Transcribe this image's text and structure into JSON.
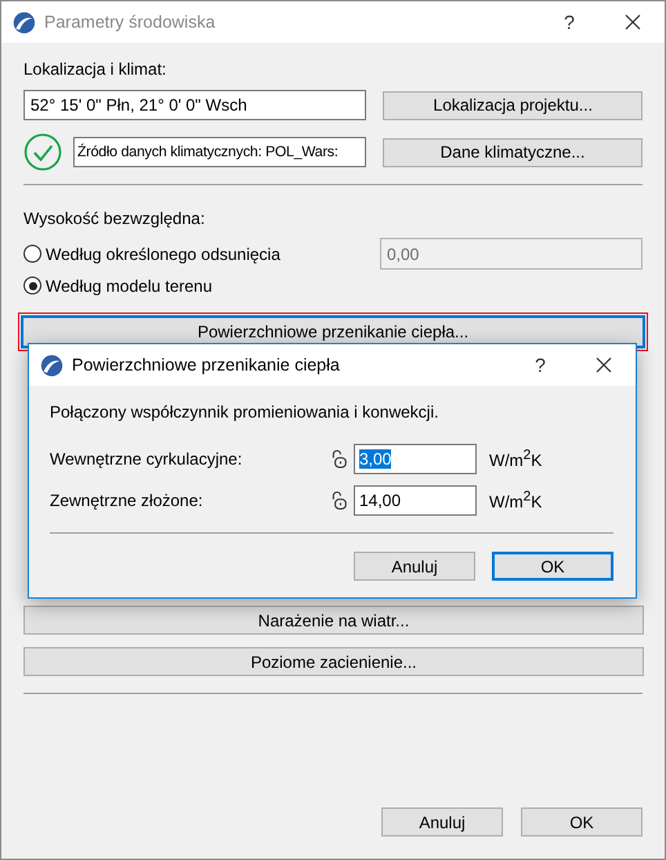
{
  "window": {
    "title": "Parametry środowiska",
    "help": "?"
  },
  "location": {
    "label": "Lokalizacja i klimat:",
    "coordinates": "52° 15' 0\" Płn, 21° 0' 0\" Wsch",
    "button": "Lokalizacja projektu..."
  },
  "climate": {
    "valid": true,
    "source": "Źródło danych klimatycznych: POL_Wars:",
    "button": "Dane klimatyczne..."
  },
  "elevation": {
    "label": "Wysokość bezwzględna:",
    "options": [
      {
        "label": "Według określonego odsunięcia",
        "selected": false
      },
      {
        "label": "Według modelu terenu",
        "selected": true
      }
    ],
    "offset_value": "0,00",
    "offset_disabled": true
  },
  "heat_button": {
    "label": "Powierzchniowe przenikanie ciepła...",
    "focused": true
  },
  "wind_button": "Narażenie na wiatr...",
  "shading_button": "Poziome zacienienie...",
  "buttons": [
    {
      "label": "Anuluj",
      "default": false
    },
    {
      "label": "OK",
      "default": false
    }
  ],
  "dialog": {
    "title": "Powierzchniowe przenikanie ciepła",
    "help": "?",
    "description": "Połączony współczynnik promieniowania i konwekcji.",
    "rows": [
      {
        "label": "Wewnętrzne cyrkulacyjne:",
        "value": "3,00",
        "unit": "W/m$^{2}$K",
        "locked": false,
        "focused": true
      },
      {
        "label": "Zewnętrzne złożone:",
        "value": "14,00",
        "unit": "W/m$^{2}$K",
        "locked": false,
        "focused": false
      }
    ],
    "buttons": [
      {
        "label": "Anuluj",
        "default": false
      },
      {
        "label": "OK",
        "default": true
      }
    ]
  }
}
